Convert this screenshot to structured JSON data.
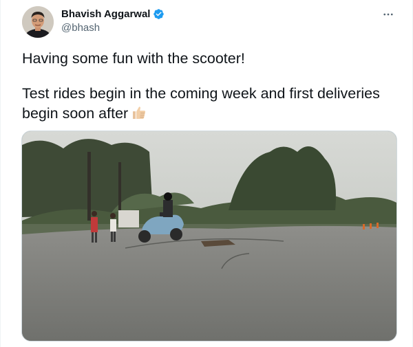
{
  "author": {
    "display_name": "Bhavish Aggarwal",
    "handle": "@bhash",
    "verified": true,
    "avatar_icon": "avatar-photo"
  },
  "tweet": {
    "line1": "Having some fun with the scooter!",
    "line2": "Test rides begin in the coming week and first deliveries",
    "line3": "begin soon after",
    "emoji_icon": "thumbs-up-icon"
  },
  "media": {
    "type": "video",
    "description_icon": "scooter-video-thumbnail"
  },
  "colors": {
    "text": "#0f1419",
    "secondary": "#536471",
    "verified": "#1d9bf0",
    "border": "#cfd9de"
  },
  "icons": {
    "more": "more-dots-icon",
    "verified": "verified-badge-icon"
  }
}
